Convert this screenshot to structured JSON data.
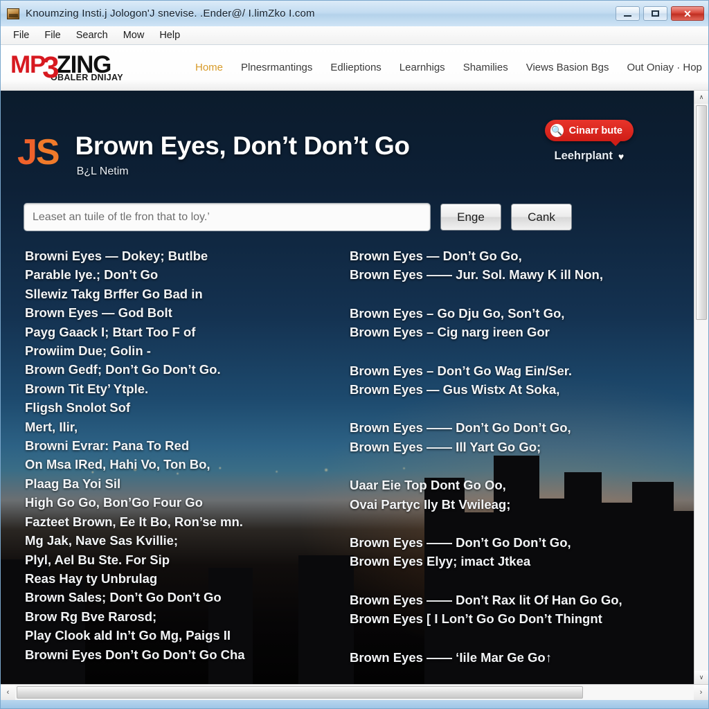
{
  "window": {
    "title": "Knoumzing Insti.j Jologon'J snevise. .Ender@/ I.limZko I.com",
    "icon": "app-icon",
    "buttons": {
      "minimize": "minimize",
      "maximize": "maximize",
      "close": "close"
    }
  },
  "menubar": {
    "items": [
      "File",
      "File",
      "Search",
      "Mow",
      "Help"
    ]
  },
  "site_header": {
    "logo": {
      "mp": "MP",
      "three": "3",
      "zing": "ZING",
      "tagline": "OBALER DNIJAY"
    },
    "nav": [
      {
        "label": "Home",
        "active": true
      },
      {
        "label": "Plnesrmantings",
        "active": false
      },
      {
        "label": "Edlieptions",
        "active": false
      },
      {
        "label": "Learnhigs",
        "active": false
      },
      {
        "label": "Shamilies",
        "active": false
      },
      {
        "label": "Views Basion Bgs",
        "active": false
      },
      {
        "label": "Out Oniay · Hop",
        "active": false
      }
    ]
  },
  "hero": {
    "badge_j": "J",
    "badge_s": "S",
    "title": "Brown Eyes, Don’t Don’t Go",
    "subtitle": "B¿L Netim"
  },
  "topright": {
    "pill_icon": "search-icon",
    "pill_label": "Cinarr bute",
    "caption": "Leehrplant",
    "caption_icon": "heart-icon"
  },
  "search": {
    "placeholder": "Leaset an tuile of tle fron that to loy.’",
    "value": "",
    "submit_label": "Enge",
    "cancel_label": "Cank"
  },
  "results": {
    "left_groups": [
      [
        "Browni Eyes — Dokey; Butlbe",
        "Parable Iye.; Don’t Go",
        "Sllewiz Takg Brffer Go Bad in",
        "Brown Eyes — God Bolt",
        "Payg Gaack I; Btart Too F of",
        "Prowiim Due; Golin -",
        "Brown Gedf; Don’t Go Don’t Go.",
        "Brown Tit Ety’ Ytple.",
        "Fligsh Snolot Sof",
        "Mert, Ilir,",
        "Browni Evrar: Pana To Red",
        "On Msa IRed, Hahi Vo, Ton Bo,",
        "Plaag Ba Yoi Sil",
        "High Go Go, Bon’Go Four Go",
        "Fazteet Brown, Ee It Bo, Ron’se mn.",
        "Mg Jak, Nave Sas Kvillie;",
        "Plyl, Ael Bu Ste. For Sip",
        "Reas Hay ty Unbrulag",
        "Brown Sales; Don’t Go Don’t Go",
        "Brow Rg Bve Rarosd;",
        "Play Clook ald In’t Go Mg, Paigs II",
        "Browni Eyes Don’t Go Don’t Go Cha"
      ]
    ],
    "right_groups": [
      [
        "Brown Eyes — Don’t Go Go,",
        "Brown Eyes —— Jur. Sol. Mawy K ill Non,"
      ],
      [
        "Brown Eyes – Go Dju Go, Son’t Go,",
        "Brown Eyes – Cig narg ireen Gor"
      ],
      [
        "Brown Eyes – Don’t Go Wag Ein/Ser.",
        "Brown Eyes — Gus Wistx At Soka,"
      ],
      [
        "Brown Eyes —— Don’t Go Don’t Go,",
        "Brown Eyes —— Ill Yart Go Go;"
      ],
      [
        "Uaar Eie Top Dont Go Oo,",
        "Ovai Partyc Ily Bt Vwileag;"
      ],
      [
        "Brown Eyes —— Don’t Go Don’t Go,",
        "Brown Eyes Elyy; imact Jtkea"
      ],
      [
        "Brown Eyes —— Don’t Rax lit Of Han Go Go,",
        "Brown Eyes [ I Lon’t Go Go Don’t Thingnt"
      ],
      [
        "Brown Eyes —— ‘Iile Mar Ge Go↑"
      ]
    ]
  },
  "scrollbars": {
    "vertical_up": "∧",
    "vertical_down": "∨",
    "horizontal_left": "‹",
    "horizontal_right": "›"
  }
}
